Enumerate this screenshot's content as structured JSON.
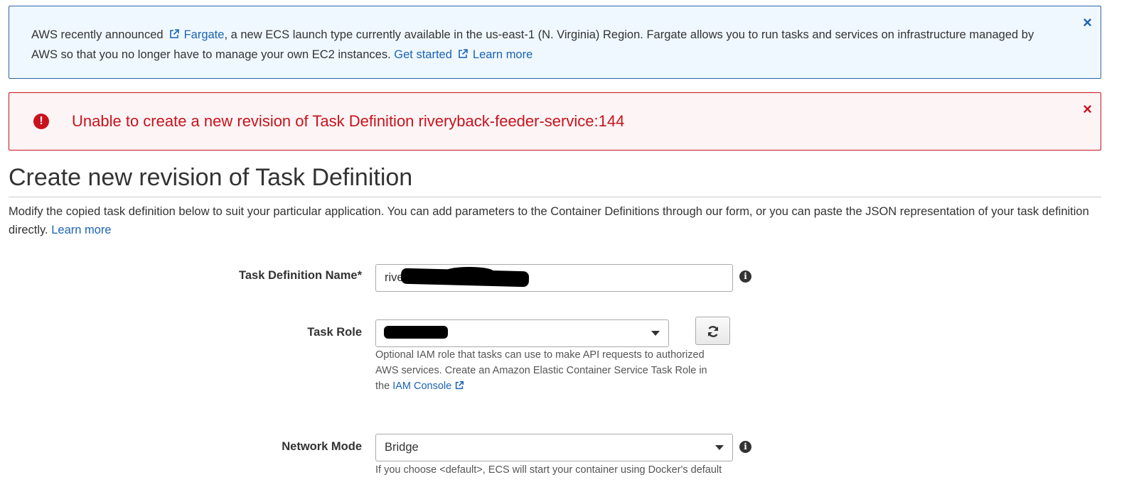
{
  "info_alert": {
    "pre": "AWS recently announced",
    "fargate_link": "Fargate",
    "mid": ", a new ECS launch type currently available in the us-east-1 (N. Virginia) Region. Fargate allows you to run tasks and services on infrastructure managed by AWS so that you no longer have to manage your own EC2 instances.",
    "get_started_link": "Get started",
    "learn_more_link": "Learn more",
    "close": "×"
  },
  "error_alert": {
    "message": "Unable to create a new revision of Task Definition riveryback-feeder-service:144",
    "icon": "!",
    "close": "×"
  },
  "page": {
    "title": "Create new revision of Task Definition",
    "intro": "Modify the copied task definition below to suit your particular application. You can add parameters to the Container Definitions through our form, or you can paste the JSON representation of your task definition directly.",
    "intro_link": "Learn more"
  },
  "form": {
    "task_definition_name": {
      "label": "Task Definition Name*",
      "value": "riveryba"
    },
    "task_role": {
      "label": "Task Role",
      "value": "",
      "help": "Optional IAM role that tasks can use to make API requests to authorized AWS services. Create an Amazon Elastic Container Service Task Role in the",
      "help_link": "IAM Console"
    },
    "network_mode": {
      "label": "Network Mode",
      "value": "Bridge",
      "help": "If you choose <default>, ECS will start your container using Docker's default"
    },
    "info_glyph": "i"
  },
  "colors": {
    "link": "#1b63b5",
    "info_border": "#2e63a7",
    "info_bg": "#f0f8ff",
    "error": "#c9121e",
    "error_bg": "#fdf5f5"
  },
  "icons": [
    "external-link-icon",
    "close-icon",
    "error-icon",
    "info-icon",
    "chevron-down-icon",
    "refresh-icon"
  ]
}
